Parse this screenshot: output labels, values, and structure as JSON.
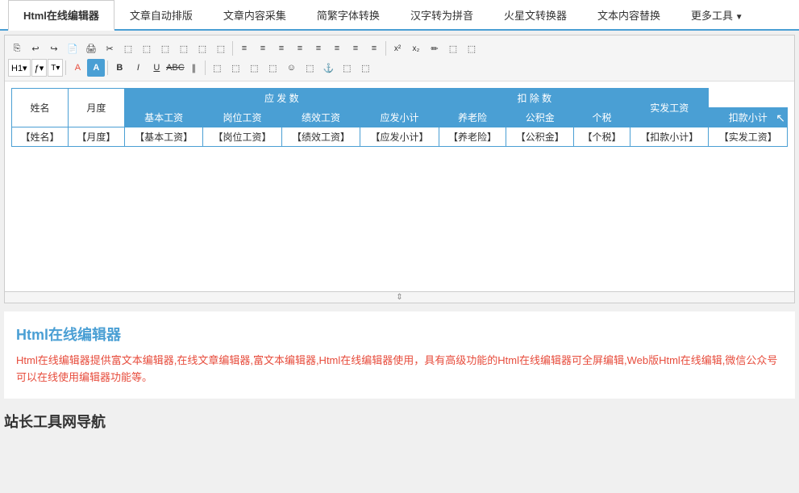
{
  "topnav": {
    "tabs": [
      {
        "label": "Html在线编辑器",
        "active": true
      },
      {
        "label": "文章自动排版",
        "active": false
      },
      {
        "label": "文章内容采集",
        "active": false
      },
      {
        "label": "简繁字体转换",
        "active": false
      },
      {
        "label": "汉字转为拼音",
        "active": false
      },
      {
        "label": "火星文转换器",
        "active": false
      },
      {
        "label": "文本内容替换",
        "active": false
      },
      {
        "label": "更多工具",
        "active": false,
        "dropdown": true
      }
    ]
  },
  "toolbar": {
    "row1_buttons": [
      "⎘",
      "↩",
      "↪",
      "⬚",
      "🖨",
      "✂",
      "⬚",
      "⬚",
      "⬚",
      "⬚",
      "⬚",
      "⬚",
      "≡",
      "≡",
      "≡",
      "≡",
      "≡",
      "≡",
      "≡",
      "≡",
      "x²",
      "x₂",
      "✏",
      "⬚",
      "⬚"
    ],
    "row2_buttons": [
      "H1",
      "ƒ",
      "T",
      "A",
      "A",
      "B",
      "I",
      "U",
      "ABC",
      "∥",
      "⬚",
      "⬚",
      "⬚",
      "⬚",
      "⬚",
      "☺",
      "⬚",
      "⬚",
      "⚓",
      "⬚",
      "⬚"
    ]
  },
  "table": {
    "header_row1": [
      {
        "text": "姓名",
        "rowspan": 2,
        "type": "white"
      },
      {
        "text": "月度",
        "rowspan": 2,
        "type": "white"
      },
      {
        "text": "应 发 数",
        "colspan": 4,
        "type": "blue"
      },
      {
        "text": "",
        "colspan": 0
      },
      {
        "text": "扣 除 数",
        "colspan": 3,
        "type": "blue"
      },
      {
        "text": "",
        "colspan": 0
      },
      {
        "text": "",
        "colspan": 0
      },
      {
        "text": "实发工资",
        "rowspan": 2,
        "type": "blue"
      }
    ],
    "header_row2": [
      {
        "text": "基本工资",
        "type": "blue"
      },
      {
        "text": "岗位工资",
        "type": "blue"
      },
      {
        "text": "绩效工资",
        "type": "blue"
      },
      {
        "text": "应发小计",
        "type": "blue"
      },
      {
        "text": "养老险",
        "type": "blue"
      },
      {
        "text": "公积金",
        "type": "blue"
      },
      {
        "text": "个税",
        "type": "blue"
      },
      {
        "text": "扣款小计",
        "type": "blue"
      }
    ],
    "data_row": [
      "【姓名】",
      "【月度】",
      "【基本工资】",
      "【岗位工资】",
      "【绩效工资】",
      "【应发小计】",
      "【养老险】",
      "【公积金】",
      "【个税】",
      "【扣款小计】",
      "【实发工资】"
    ]
  },
  "info": {
    "title": "Html在线编辑器",
    "text": "Html在线编辑器提供富文本编辑器,在线文章编辑器,富文本编辑器,Html在线编辑器使用，具有高级功能的Html在线编辑器可全屏编辑,Web版Html在线编辑,微信公众号可以在线使用编辑器功能等。",
    "nav_title": "站长工具网导航"
  }
}
